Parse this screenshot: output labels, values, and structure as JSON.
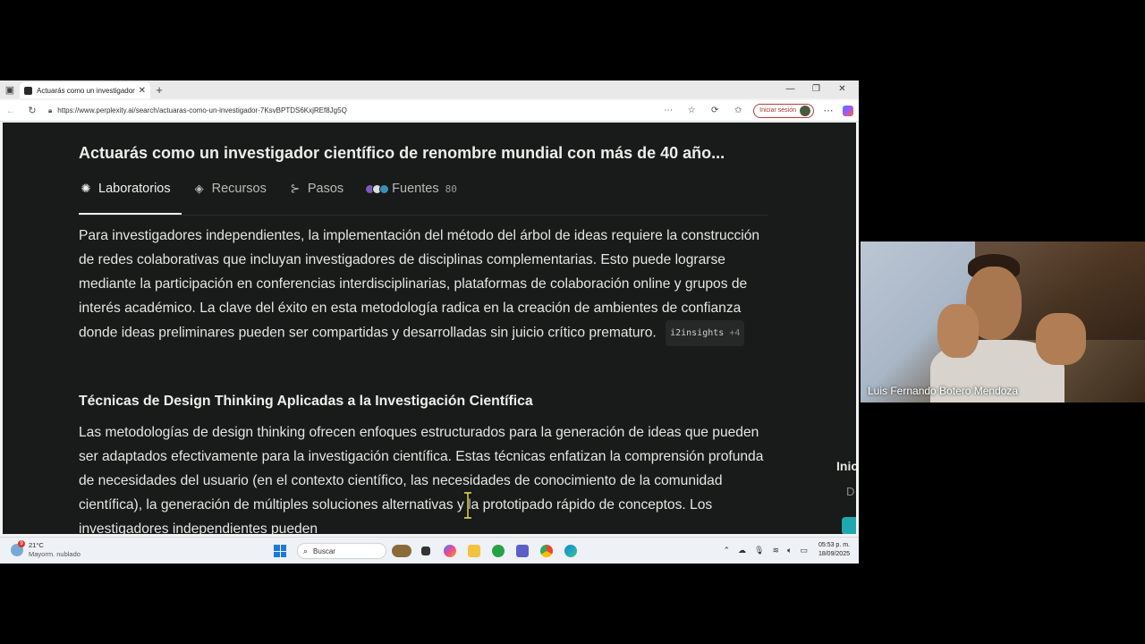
{
  "browser": {
    "tab_title": "Actuarás como un investigador c",
    "url": "https://www.perplexity.ai/search/actuaras-como-un-investigador-7KsvBPTDS6KxjREf8Jg5Q",
    "signin_label": "Iniciar sesión"
  },
  "page": {
    "top_fade_text": "",
    "query": "Actuarás como un investigador científico de renombre mundial con más de 40 año...",
    "tabs": [
      {
        "label": "Laboratorios",
        "icon": "labs-icon"
      },
      {
        "label": "Recursos",
        "icon": "layers-icon"
      },
      {
        "label": "Pasos",
        "icon": "steps-icon"
      },
      {
        "label": "Fuentes",
        "icon": "sources-icon",
        "count": "80"
      }
    ],
    "paragraph1": "Para investigadores independientes, la implementación del método del árbol de ideas requiere la construcción de redes colaborativas que incluyan investigadores de disciplinas complementarias. Esto puede lograrse mediante la participación en conferencias interdisciplinarias, plataformas de colaboración online y grupos de interés académico. La clave del éxito en esta metodología radica en la creación de ambientes de confianza donde ideas preliminares pueden ser compartidas y desarrolladas sin juicio crítico prematuro.",
    "citation1": {
      "source": "i2insights",
      "more": "+4"
    },
    "heading": "Técnicas de Design Thinking Aplicadas a la Investigación Científica",
    "paragraph2": "Las metodologías de design thinking ofrecen enfoques estructurados para la generación de ideas que pueden ser adaptados efectivamente para la investigación científica. Estas técnicas enfatizan la comprensión profunda de necesidades del usuario (en el contexto científico, las necesidades de conocimiento de la comunidad científica), la generación de múltiples soluciones alternativas y la prototipado rápido de conceptos. Los investigadores independientes pueden",
    "side_text": "Inic",
    "side_text2": "D"
  },
  "taskbar": {
    "weather_temp": "21°C",
    "weather_condition": "Mayorm. nublado",
    "weather_badge": "9",
    "search_label": "Buscar",
    "time": "05:53 p. m.",
    "date": "18/09/2025"
  },
  "webcam": {
    "participant_name": "Luis Fernando Botero Mendoza"
  },
  "colors": {
    "page_bg": "#191a1a",
    "accent_teal": "#20a8b0"
  }
}
